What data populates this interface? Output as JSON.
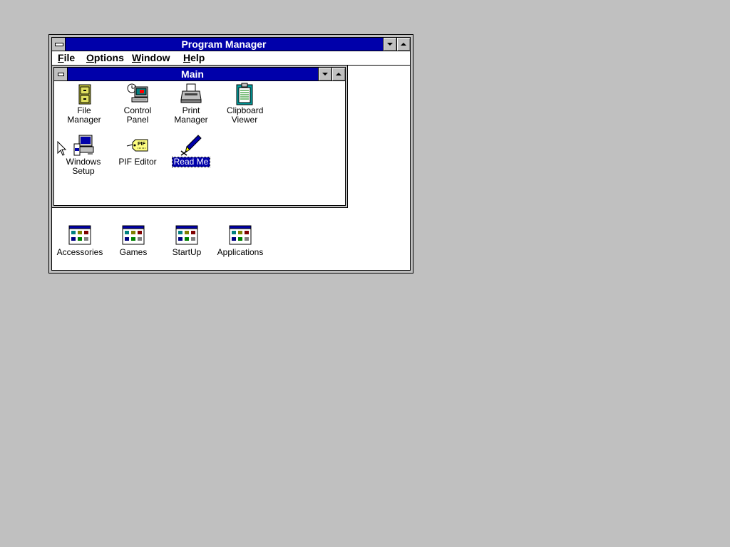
{
  "program_manager": {
    "title": "Program Manager",
    "menu": [
      "File",
      "Options",
      "Window",
      "Help"
    ],
    "menu_hotkeys": [
      "F",
      "O",
      "W",
      "H"
    ]
  },
  "main_group": {
    "title": "Main",
    "icons": [
      {
        "label": "File Manager",
        "icon": "file-cabinet-icon"
      },
      {
        "label": "Control Panel",
        "icon": "control-panel-icon"
      },
      {
        "label": "Print Manager",
        "icon": "printer-icon"
      },
      {
        "label": "Clipboard Viewer",
        "icon": "clipboard-icon"
      },
      {
        "label": "Windows Setup",
        "icon": "computer-setup-icon"
      },
      {
        "label": "PIF Editor",
        "icon": "pif-tag-icon"
      },
      {
        "label": "Read Me",
        "icon": "pen-write-icon",
        "selected": true
      }
    ]
  },
  "minimized_groups": [
    {
      "label": "Accessories"
    },
    {
      "label": "Games"
    },
    {
      "label": "StartUp"
    },
    {
      "label": "Applications"
    }
  ],
  "colors": {
    "desktop": "#c0c0c0",
    "titlebar_active": "#0000aa",
    "selection": "#0000aa"
  }
}
